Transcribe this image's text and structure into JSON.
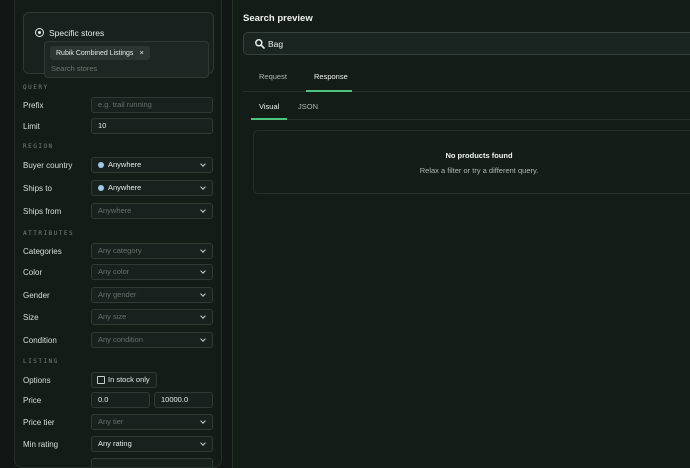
{
  "stores": {
    "mode_label": "Specific stores",
    "chip_label": "Rubik Combined Listings",
    "chip_remove": "×",
    "search_placeholder": "Search stores"
  },
  "sections": {
    "query": "QUERY",
    "region": "REGION",
    "attributes": "ATTRIBUTES",
    "listing": "LISTING"
  },
  "query": {
    "prefix_label": "Prefix",
    "prefix_placeholder": "e.g. trail running",
    "limit_label": "Limit",
    "limit_value": "10"
  },
  "region": {
    "buyer_country_label": "Buyer country",
    "buyer_country_value": "Anywhere",
    "ships_to_label": "Ships to",
    "ships_to_value": "Anywhere",
    "ships_from_label": "Ships from",
    "ships_from_placeholder": "Anywhere"
  },
  "attributes": {
    "categories_label": "Categories",
    "categories_placeholder": "Any category",
    "color_label": "Color",
    "color_placeholder": "Any color",
    "gender_label": "Gender",
    "gender_placeholder": "Any gender",
    "size_label": "Size",
    "size_placeholder": "Any size",
    "condition_label": "Condition",
    "condition_placeholder": "Any condition"
  },
  "listing": {
    "options_label": "Options",
    "in_stock_label": "In stock only",
    "in_stock_checked": false,
    "price_label": "Price",
    "price_min": "0.0",
    "price_max": "10000.0",
    "price_tier_label": "Price tier",
    "price_tier_placeholder": "Any tier",
    "min_rating_label": "Min rating",
    "min_rating_value": "Any rating"
  },
  "preview": {
    "title": "Search preview",
    "search_value": "Bag",
    "tabs": [
      "Request",
      "Response"
    ],
    "active_tab": "Response",
    "subtabs": [
      "Visual",
      "JSON"
    ],
    "active_subtab": "Visual",
    "empty_title": "No products found",
    "empty_subtitle": "Relax a filter or try a different query."
  },
  "colors": {
    "accent": "#4fc37f",
    "background": "#101714",
    "panel": "#141c18",
    "region_dot": "#9ec9e8"
  }
}
